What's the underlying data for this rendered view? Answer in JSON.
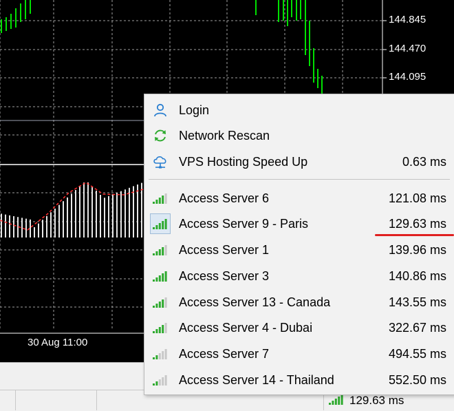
{
  "chart": {
    "price_labels": [
      "144.845",
      "144.470",
      "144.095"
    ],
    "time_label": "30 Aug 11:00"
  },
  "menu": {
    "items": [
      {
        "label": "Login",
        "icon": "user-icon"
      },
      {
        "label": "Network Rescan",
        "icon": "refresh-icon"
      },
      {
        "label": "VPS Hosting Speed Up",
        "icon": "cloud-network-icon",
        "ping": "0.63 ms"
      }
    ],
    "servers": [
      {
        "label": "Access Server 6",
        "ping": "121.08 ms",
        "signal_bars": 4,
        "selected": false
      },
      {
        "label": "Access Server 9 - Paris",
        "ping": "129.63 ms",
        "signal_bars": 5,
        "selected": true
      },
      {
        "label": "Access Server 1",
        "ping": "139.96 ms",
        "signal_bars": 4,
        "selected": false
      },
      {
        "label": "Access Server 3",
        "ping": "140.86 ms",
        "signal_bars": 5,
        "selected": false
      },
      {
        "label": "Access Server 13 - Canada",
        "ping": "143.55 ms",
        "signal_bars": 4,
        "selected": false
      },
      {
        "label": "Access Server 4 - Dubai",
        "ping": "322.67 ms",
        "signal_bars": 4,
        "selected": false
      },
      {
        "label": "Access Server 7",
        "ping": "494.55 ms",
        "signal_bars": 2,
        "selected": false
      },
      {
        "label": "Access Server 14 - Thailand",
        "ping": "552.50 ms",
        "signal_bars": 2,
        "selected": false
      }
    ]
  },
  "status": {
    "connection_ping": "129.63 ms",
    "connection_signal_bars": 5
  },
  "colors": {
    "chart_bg": "#000000",
    "candle_green": "#00e000",
    "grid": "#a0a0a0",
    "signal_on": "#2eaa2e",
    "signal_off": "#c8c8c8",
    "highlight_underline": "#e02020"
  }
}
